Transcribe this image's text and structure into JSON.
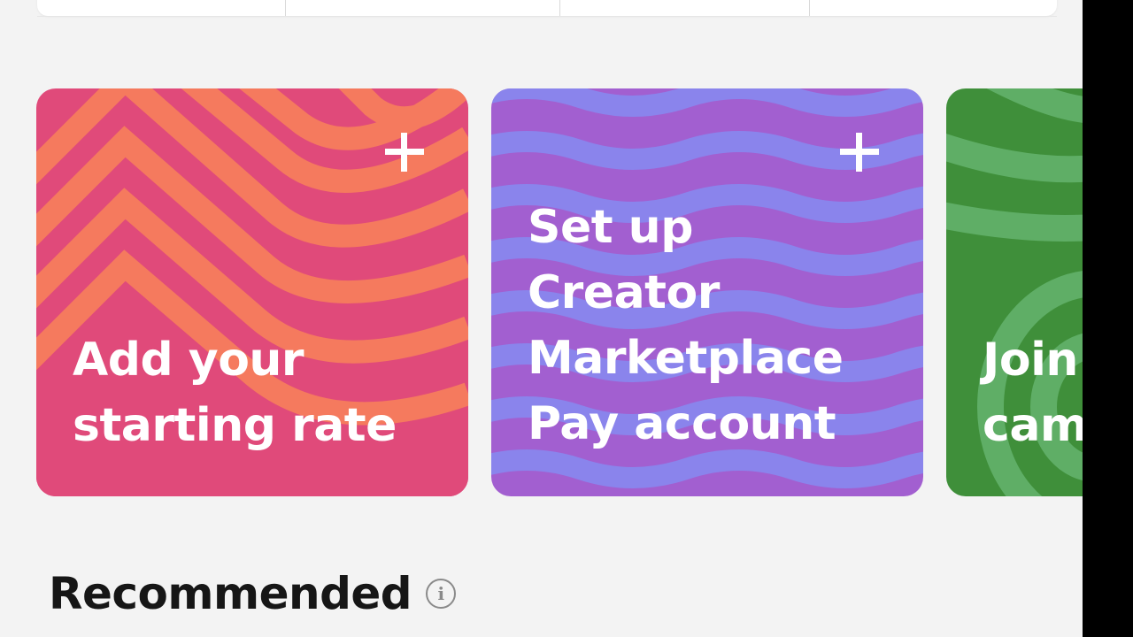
{
  "cards": [
    {
      "id": "starting-rate",
      "title": "Add your\nstarting rate",
      "icon": "plus-icon",
      "colors": {
        "base": "#e04a7a",
        "stripe": "#f57a5e"
      }
    },
    {
      "id": "marketplace-pay",
      "title": "Set up\nCreator\nMarketplace\nPay account",
      "icon": "plus-icon",
      "colors": {
        "base": "#a25fd0",
        "stripe": "#8a84ec"
      }
    },
    {
      "id": "join-campaign",
      "title": "Join\ncam",
      "colors": {
        "base": "#3f8f3a",
        "stripe": "#5fae66"
      }
    }
  ],
  "section": {
    "title": "Recommended",
    "info_icon": "info-icon",
    "info_glyph": "i"
  }
}
